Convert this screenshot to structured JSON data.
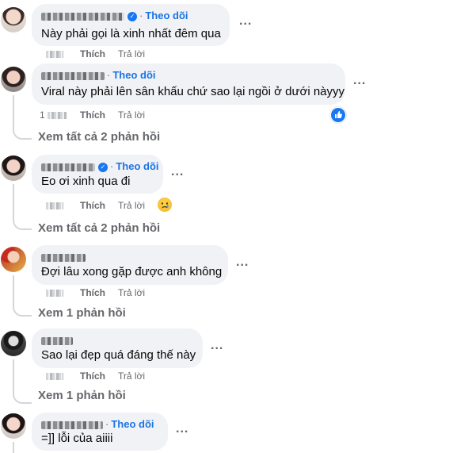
{
  "labels": {
    "follow": "Theo dõi",
    "like": "Thích",
    "reply": "Trả lời",
    "more": "..."
  },
  "comments": [
    {
      "text": "Này phải gọi là xinh nhất đêm qua",
      "verified": true,
      "follow": true
    },
    {
      "text": "Viral này phải lên sân khấu chứ sao lại ngồi ở dưới nàyyy",
      "verified": false,
      "follow": true,
      "time_prefix": "1",
      "reaction": "like-icon",
      "replies": "Xem tất cả 2 phản hồi"
    },
    {
      "text": "Eo ơi xinh qua đi",
      "verified": true,
      "follow": true,
      "reaction": "sad-icon",
      "replies": "Xem tất cả 2 phản hồi"
    },
    {
      "text": "Đợi lâu xong gặp được anh không",
      "verified": false,
      "follow": false,
      "replies": "Xem 1 phản hồi"
    },
    {
      "text": "Sao lại đẹp quá đáng thế này",
      "verified": false,
      "follow": false,
      "replies": "Xem 1 phản hồi"
    },
    {
      "text": "=]] lỗi của aiiii",
      "verified": false,
      "follow": true
    }
  ]
}
